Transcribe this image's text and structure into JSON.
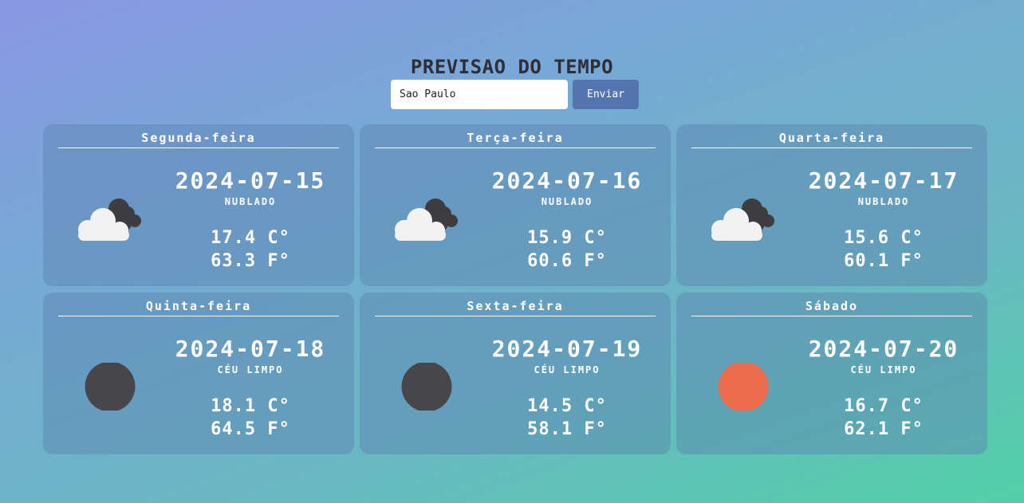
{
  "header": {
    "title": "PREVISAO DO TEMPO"
  },
  "search": {
    "value": "Sao Paulo",
    "button_label": "Enviar"
  },
  "days": [
    {
      "day": "Segunda-feira",
      "date": "2024-07-15",
      "condition": "NUBLADO",
      "temp_c": "17.4 C°",
      "temp_f": "63.3 F°",
      "icon": "cloudy-icon"
    },
    {
      "day": "Terça-feira",
      "date": "2024-07-16",
      "condition": "NUBLADO",
      "temp_c": "15.9 C°",
      "temp_f": "60.6 F°",
      "icon": "cloudy-icon"
    },
    {
      "day": "Quarta-feira",
      "date": "2024-07-17",
      "condition": "NUBLADO",
      "temp_c": "15.6 C°",
      "temp_f": "60.1 F°",
      "icon": "cloudy-icon"
    },
    {
      "day": "Quinta-feira",
      "date": "2024-07-18",
      "condition": "CÉU LIMPO",
      "temp_c": "18.1 C°",
      "temp_f": "64.5 F°",
      "icon": "moon-icon"
    },
    {
      "day": "Sexta-feira",
      "date": "2024-07-19",
      "condition": "CÉU LIMPO",
      "temp_c": "14.5 C°",
      "temp_f": "58.1 F°",
      "icon": "moon-icon"
    },
    {
      "day": "Sábado",
      "date": "2024-07-20",
      "condition": "CÉU LIMPO",
      "temp_c": "16.7 C°",
      "temp_f": "62.1 F°",
      "icon": "sun-icon"
    }
  ],
  "colors": {
    "button": "#5575b0",
    "title": "#2e2e36",
    "moon": "#47474b",
    "sun": "#ec6c4e",
    "cloud_front": "#f2f2f2",
    "cloud_back": "#3d3d40"
  }
}
